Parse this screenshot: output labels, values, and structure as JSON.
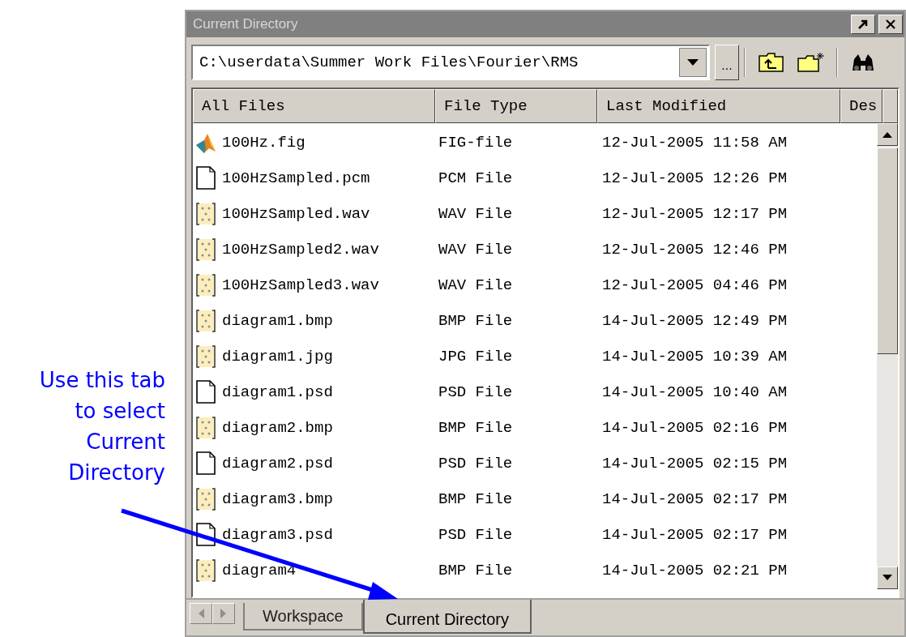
{
  "annotation": {
    "text": "Use this tab to select Current Directory"
  },
  "panel": {
    "title": "Current Directory",
    "path": "C:\\userdata\\Summer Work Files\\Fourier\\RMS",
    "browse_button": "...",
    "columns": [
      "All Files",
      "File Type",
      "Last Modified",
      "Des"
    ],
    "rows": [
      {
        "name": "100Hz.fig",
        "kind": "fig",
        "type": "FIG-file",
        "modified": "12-Jul-2005 11:58 AM"
      },
      {
        "name": "100HzSampled.pcm",
        "kind": "file",
        "type": "PCM File",
        "modified": "12-Jul-2005 12:26 PM"
      },
      {
        "name": "100HzSampled.wav",
        "kind": "media",
        "type": "WAV File",
        "modified": "12-Jul-2005 12:17 PM"
      },
      {
        "name": "100HzSampled2.wav",
        "kind": "media",
        "type": "WAV File",
        "modified": "12-Jul-2005 12:46 PM"
      },
      {
        "name": "100HzSampled3.wav",
        "kind": "media",
        "type": "WAV File",
        "modified": "12-Jul-2005 04:46 PM"
      },
      {
        "name": "diagram1.bmp",
        "kind": "media",
        "type": "BMP File",
        "modified": "14-Jul-2005 12:49 PM"
      },
      {
        "name": "diagram1.jpg",
        "kind": "media",
        "type": "JPG File",
        "modified": "14-Jul-2005 10:39 AM"
      },
      {
        "name": "diagram1.psd",
        "kind": "file",
        "type": "PSD File",
        "modified": "14-Jul-2005 10:40 AM"
      },
      {
        "name": "diagram2.bmp",
        "kind": "media",
        "type": "BMP File",
        "modified": "14-Jul-2005 02:16 PM"
      },
      {
        "name": "diagram2.psd",
        "kind": "file",
        "type": "PSD File",
        "modified": "14-Jul-2005 02:15 PM"
      },
      {
        "name": "diagram3.bmp",
        "kind": "media",
        "type": "BMP File",
        "modified": "14-Jul-2005 02:17 PM"
      },
      {
        "name": "diagram3.psd",
        "kind": "file",
        "type": "PSD File",
        "modified": "14-Jul-2005 02:17 PM"
      },
      {
        "name": "diagram4",
        "kind": "media",
        "type": "BMP File",
        "modified": "14-Jul-2005 02:21 PM"
      }
    ],
    "tabs": [
      {
        "label": "Workspace",
        "selected": false
      },
      {
        "label": "Current Directory",
        "selected": true
      }
    ]
  }
}
